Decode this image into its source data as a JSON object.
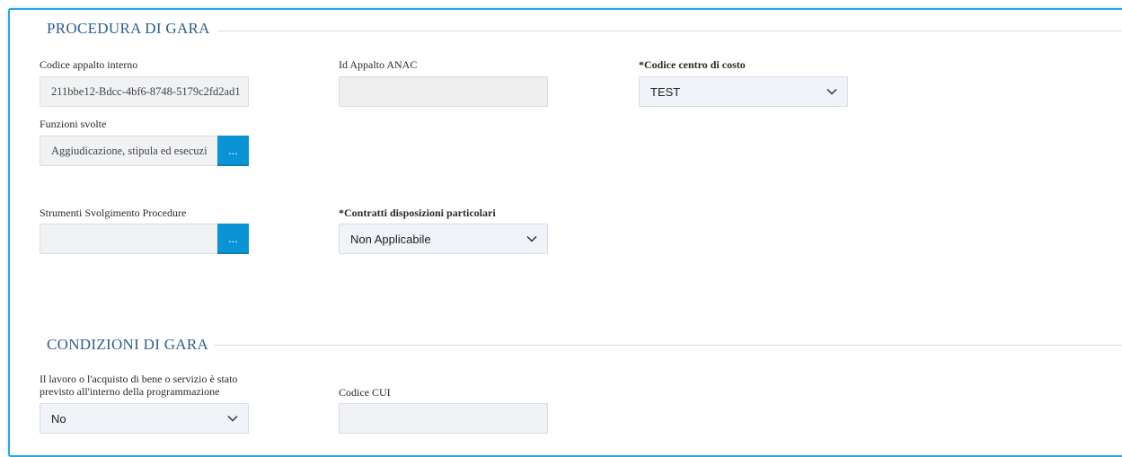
{
  "procedura": {
    "title": "PROCEDURA DI GARA",
    "codice_appalto_label": "Codice appalto interno",
    "codice_appalto_value": "211bbe12-Bdcc-4bf6-8748-5179c2fd2ad1",
    "id_anac_label": "Id Appalto ANAC",
    "id_anac_value": "",
    "centro_costo_label": "*Codice centro di costo",
    "centro_costo_value": "TEST",
    "funzioni_label": "Funzioni svolte",
    "funzioni_value": "Aggiudicazione, stipula ed esecuzi",
    "funzioni_picker": "...",
    "strumenti_label": "Strumenti Svolgimento Procedure",
    "strumenti_value": "",
    "strumenti_picker": "...",
    "contratti_label": "*Contratti disposizioni particolari",
    "contratti_value": "Non Applicabile"
  },
  "condizioni": {
    "title": "CONDIZIONI DI GARA",
    "programmazione_label_line1": "Il lavoro o l'acquisto di bene o servizio è stato",
    "programmazione_label_line2": "previsto all'interno della programmazione",
    "programmazione_value": "No",
    "cui_label": "Codice CUI",
    "cui_value": ""
  },
  "colors": {
    "accent": "#0a94d6",
    "frame": "#2aa7de",
    "section_title": "#2d5f8a"
  }
}
